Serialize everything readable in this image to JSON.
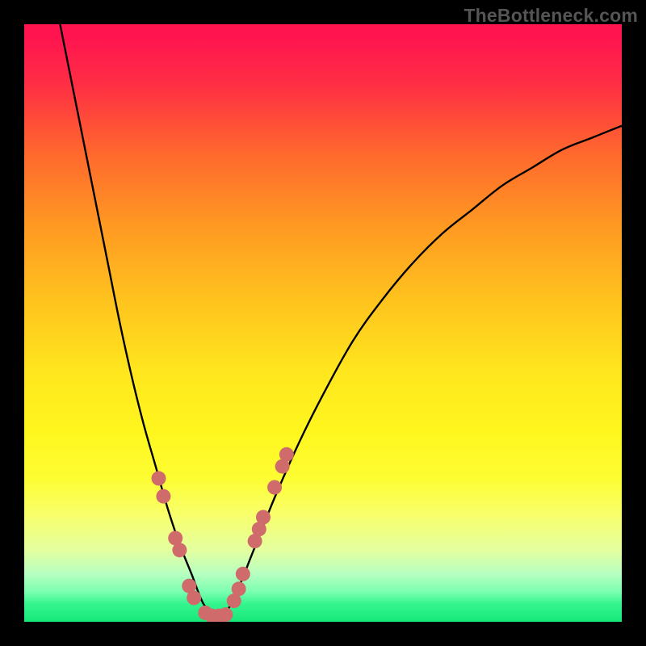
{
  "attribution": "TheBottleneck.com",
  "colors": {
    "bg": "#000000",
    "gradient_top": "#ff1450",
    "gradient_bottom": "#17e87a",
    "curve": "#000000",
    "marker": "#cf6b6b"
  },
  "chart_data": {
    "type": "line",
    "title": "",
    "xlabel": "",
    "ylabel": "",
    "xlim": [
      0,
      100
    ],
    "ylim": [
      0,
      100
    ],
    "grid": false,
    "legend": false,
    "notes": "Two curves forming a V shape on a vertical red→yellow→green gradient. The left curve descends steeply from the upper-left to a minimum near x≈30; the right curve rises from that minimum toward the right edge. Salmon-colored bead-like markers decorate the curves near the bottom of the V. Values below are read from the plot area as normalized 0–100 on each axis.",
    "series": [
      {
        "name": "left-curve",
        "x": [
          6,
          8,
          10,
          12,
          14,
          16,
          18,
          20,
          22,
          24,
          26,
          28,
          30,
          32
        ],
        "y": [
          100,
          90,
          80,
          70,
          60,
          50,
          41,
          33,
          26,
          19,
          13,
          8,
          3,
          1
        ]
      },
      {
        "name": "right-curve",
        "x": [
          32,
          34,
          36,
          38,
          40,
          42,
          46,
          50,
          55,
          60,
          65,
          70,
          75,
          80,
          85,
          90,
          95,
          100
        ],
        "y": [
          1,
          2,
          6,
          11,
          16,
          21,
          30,
          38,
          47,
          54,
          60,
          65,
          69,
          73,
          76,
          79,
          81,
          83
        ]
      }
    ],
    "markers": [
      {
        "x": 22.5,
        "y": 24
      },
      {
        "x": 23.3,
        "y": 21
      },
      {
        "x": 25.3,
        "y": 14
      },
      {
        "x": 26.0,
        "y": 12
      },
      {
        "x": 27.6,
        "y": 6
      },
      {
        "x": 28.4,
        "y": 4
      },
      {
        "x": 30.3,
        "y": 1.5
      },
      {
        "x": 31.4,
        "y": 1.0
      },
      {
        "x": 32.6,
        "y": 1.0
      },
      {
        "x": 33.7,
        "y": 1.2
      },
      {
        "x": 35.1,
        "y": 3.5
      },
      {
        "x": 35.9,
        "y": 5.5
      },
      {
        "x": 36.6,
        "y": 8.0
      },
      {
        "x": 38.6,
        "y": 13.5
      },
      {
        "x": 39.3,
        "y": 15.5
      },
      {
        "x": 40.0,
        "y": 17.5
      },
      {
        "x": 41.9,
        "y": 22.5
      },
      {
        "x": 43.2,
        "y": 26.0
      },
      {
        "x": 43.9,
        "y": 28.0
      }
    ],
    "marker_radius_px": 9
  }
}
